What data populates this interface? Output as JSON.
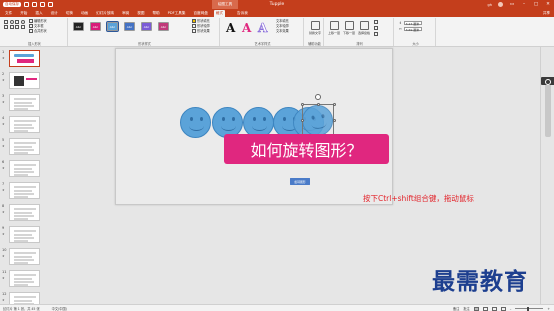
{
  "titlebar": {
    "autosave": "自动保存",
    "doc_title": "Tupple",
    "context_tab": "绘图工具",
    "user": "gh"
  },
  "tabs": [
    "文件",
    "开始",
    "插入",
    "设计",
    "切换",
    "动画",
    "幻灯片放映",
    "审阅",
    "视图",
    "帮助",
    "PDF工具集",
    "百度网盘",
    "格式"
  ],
  "active_tab": "格式",
  "tellme": "告诉我",
  "share": "共享",
  "ribbon": {
    "insert_shapes": {
      "label": "插入形状",
      "edit_shape": "编辑形状",
      "text_box": "文本框",
      "merge_shapes": "合并形状"
    },
    "shape_styles": {
      "label": "形状样式",
      "swatches": [
        {
          "text": "Abc",
          "color": "#222222"
        },
        {
          "text": "Abc",
          "color": "#d81b7a"
        },
        {
          "text": "Abc",
          "color": "#5ba3d9"
        },
        {
          "text": "Abc",
          "color": "#4472c4"
        },
        {
          "text": "Abc",
          "color": "#7b5bd6"
        },
        {
          "text": "Abc",
          "color": "#c0397a"
        }
      ],
      "fill": "形状填充",
      "outline": "形状轮廓",
      "effects": "形状效果"
    },
    "wordart": {
      "label": "艺术字样式",
      "text_fill": "文本填充",
      "text_outline": "文本轮廓",
      "text_effects": "文本效果"
    },
    "accessibility": {
      "label": "辅助功能",
      "alt_text": "替换文字"
    },
    "arrange": {
      "label": "排列",
      "bring_forward": "上移一层",
      "send_backward": "下移一层",
      "selection_pane": "选择窗格"
    },
    "size": {
      "label": "大小",
      "height": "3.27 厘米",
      "width": "3.69 厘米"
    }
  },
  "slides": [
    "1",
    "2",
    "3",
    "4",
    "5",
    "6",
    "7",
    "8",
    "9",
    "10",
    "11",
    "12"
  ],
  "slide": {
    "title": "如何旋转图形？",
    "small_label": "旋转图形",
    "instruction": "按下Ctrl+shift组合键，拖动鼠标"
  },
  "watermark": "最需教育",
  "statusbar": {
    "slide_info": "幻灯片 第 1 张，共 45 张",
    "language": "中文(中国)",
    "notes": "备注",
    "comments": "批注"
  },
  "colors": {
    "accent": "#c43e1c",
    "banner": "#e0277f",
    "smiley": "#5ba3d9",
    "instruction": "#e3242b",
    "watermark": "#1d3f8f"
  }
}
